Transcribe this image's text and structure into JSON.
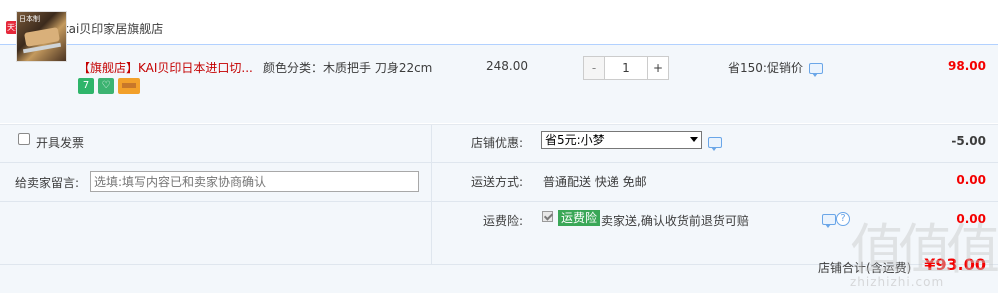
{
  "store": {
    "badge": "天猫",
    "label": "店铺: kai贝印家居旗舰店"
  },
  "item": {
    "image_caption": "日本制",
    "title_prefix": "【旗舰店】",
    "title": "KAI贝印日本进口切...",
    "sku": "颜色分类：木质把手 刀身22cm",
    "unit_price": "248.00",
    "quantity": "1",
    "qty_minus": "-",
    "qty_plus": "+",
    "promo": "省150:促销价",
    "total": "98.00",
    "service_icons": [
      "seven-day-return-icon",
      "shopping-bag-icon",
      "credit-card-icon"
    ],
    "service_seven": "7"
  },
  "options": {
    "invoice_label": "开具发票",
    "note_label": "给卖家留言:",
    "note_placeholder": "选填:填写内容已和卖家协商确认",
    "coupon_label": "店铺优惠:",
    "coupon_selected": "省5元:小梦",
    "coupon_amount": "-5.00",
    "shipping_label": "运送方式:",
    "shipping_methods": "普通配送 快递 免邮",
    "shipping_amount": "0.00",
    "insurance_label": "运费险:",
    "insurance_tag": "运费险",
    "insurance_desc": "卖家送,确认收货前退货可赔",
    "insurance_amount": "0.00",
    "help_glyph": "?"
  },
  "summary": {
    "label": "店铺合计(含运费)",
    "amount": "¥93.00"
  },
  "watermark": {
    "main": "值值值",
    "sub": "zhizhizhi.com"
  },
  "colors": {
    "accent_red": "#f40000",
    "row_bg": "#f3f7fb",
    "border_blue": "#b2d1ff",
    "tmall_red": "#e5283a",
    "insurance_green": "#3aa757"
  }
}
